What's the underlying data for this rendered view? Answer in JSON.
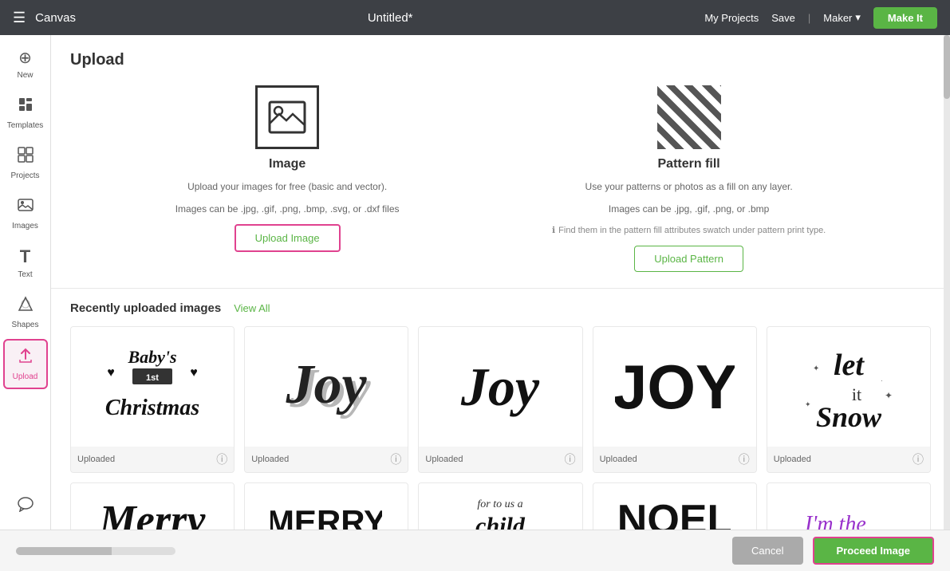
{
  "topbar": {
    "app_name": "Canvas",
    "title": "Untitled*",
    "my_projects": "My Projects",
    "save": "Save",
    "divider": "|",
    "maker": "Maker",
    "make_it": "Make It"
  },
  "sidebar": {
    "items": [
      {
        "id": "new",
        "label": "New",
        "icon": "⊕"
      },
      {
        "id": "templates",
        "label": "Templates",
        "icon": "👕"
      },
      {
        "id": "projects",
        "label": "Projects",
        "icon": "▦"
      },
      {
        "id": "images",
        "label": "Images",
        "icon": "🖼"
      },
      {
        "id": "text",
        "label": "Text",
        "icon": "T"
      },
      {
        "id": "shapes",
        "label": "Shapes",
        "icon": "✦"
      },
      {
        "id": "upload",
        "label": "Upload",
        "icon": "⬆"
      }
    ],
    "chat_icon": "💬"
  },
  "upload_panel": {
    "title": "Upload",
    "image_option": {
      "title": "Image",
      "desc1": "Upload your images for free (basic and vector).",
      "desc2": "Images can be .jpg, .gif, .png, .bmp, .svg, or .dxf files",
      "button_label": "Upload Image"
    },
    "pattern_option": {
      "title": "Pattern fill",
      "desc1": "Use your patterns or photos as a fill on any layer.",
      "desc2": "Images can be .jpg, .gif, .png, or .bmp",
      "info": "Find them in the pattern fill attributes swatch under pattern print type.",
      "button_label": "Upload Pattern"
    }
  },
  "recently_uploaded": {
    "title": "Recently uploaded images",
    "view_all": "View All",
    "images": [
      {
        "id": 1,
        "label": "Uploaded",
        "alt": "Baby's 1st Christmas"
      },
      {
        "id": 2,
        "label": "Uploaded",
        "alt": "Joy script shadow"
      },
      {
        "id": 3,
        "label": "Uploaded",
        "alt": "Joy script"
      },
      {
        "id": 4,
        "label": "Uploaded",
        "alt": "JOY bold"
      },
      {
        "id": 5,
        "label": "Uploaded",
        "alt": "Let it Snow"
      }
    ],
    "second_row": [
      {
        "id": 6,
        "label": "",
        "alt": "Merry"
      },
      {
        "id": 7,
        "label": "",
        "alt": "MERRY bold"
      },
      {
        "id": 8,
        "label": "",
        "alt": "for to us a child"
      },
      {
        "id": 9,
        "label": "",
        "alt": "NOEL"
      },
      {
        "id": 10,
        "label": "",
        "alt": "I'm the"
      }
    ]
  },
  "footer": {
    "cancel_label": "Cancel",
    "proceed_label": "Proceed Image"
  }
}
